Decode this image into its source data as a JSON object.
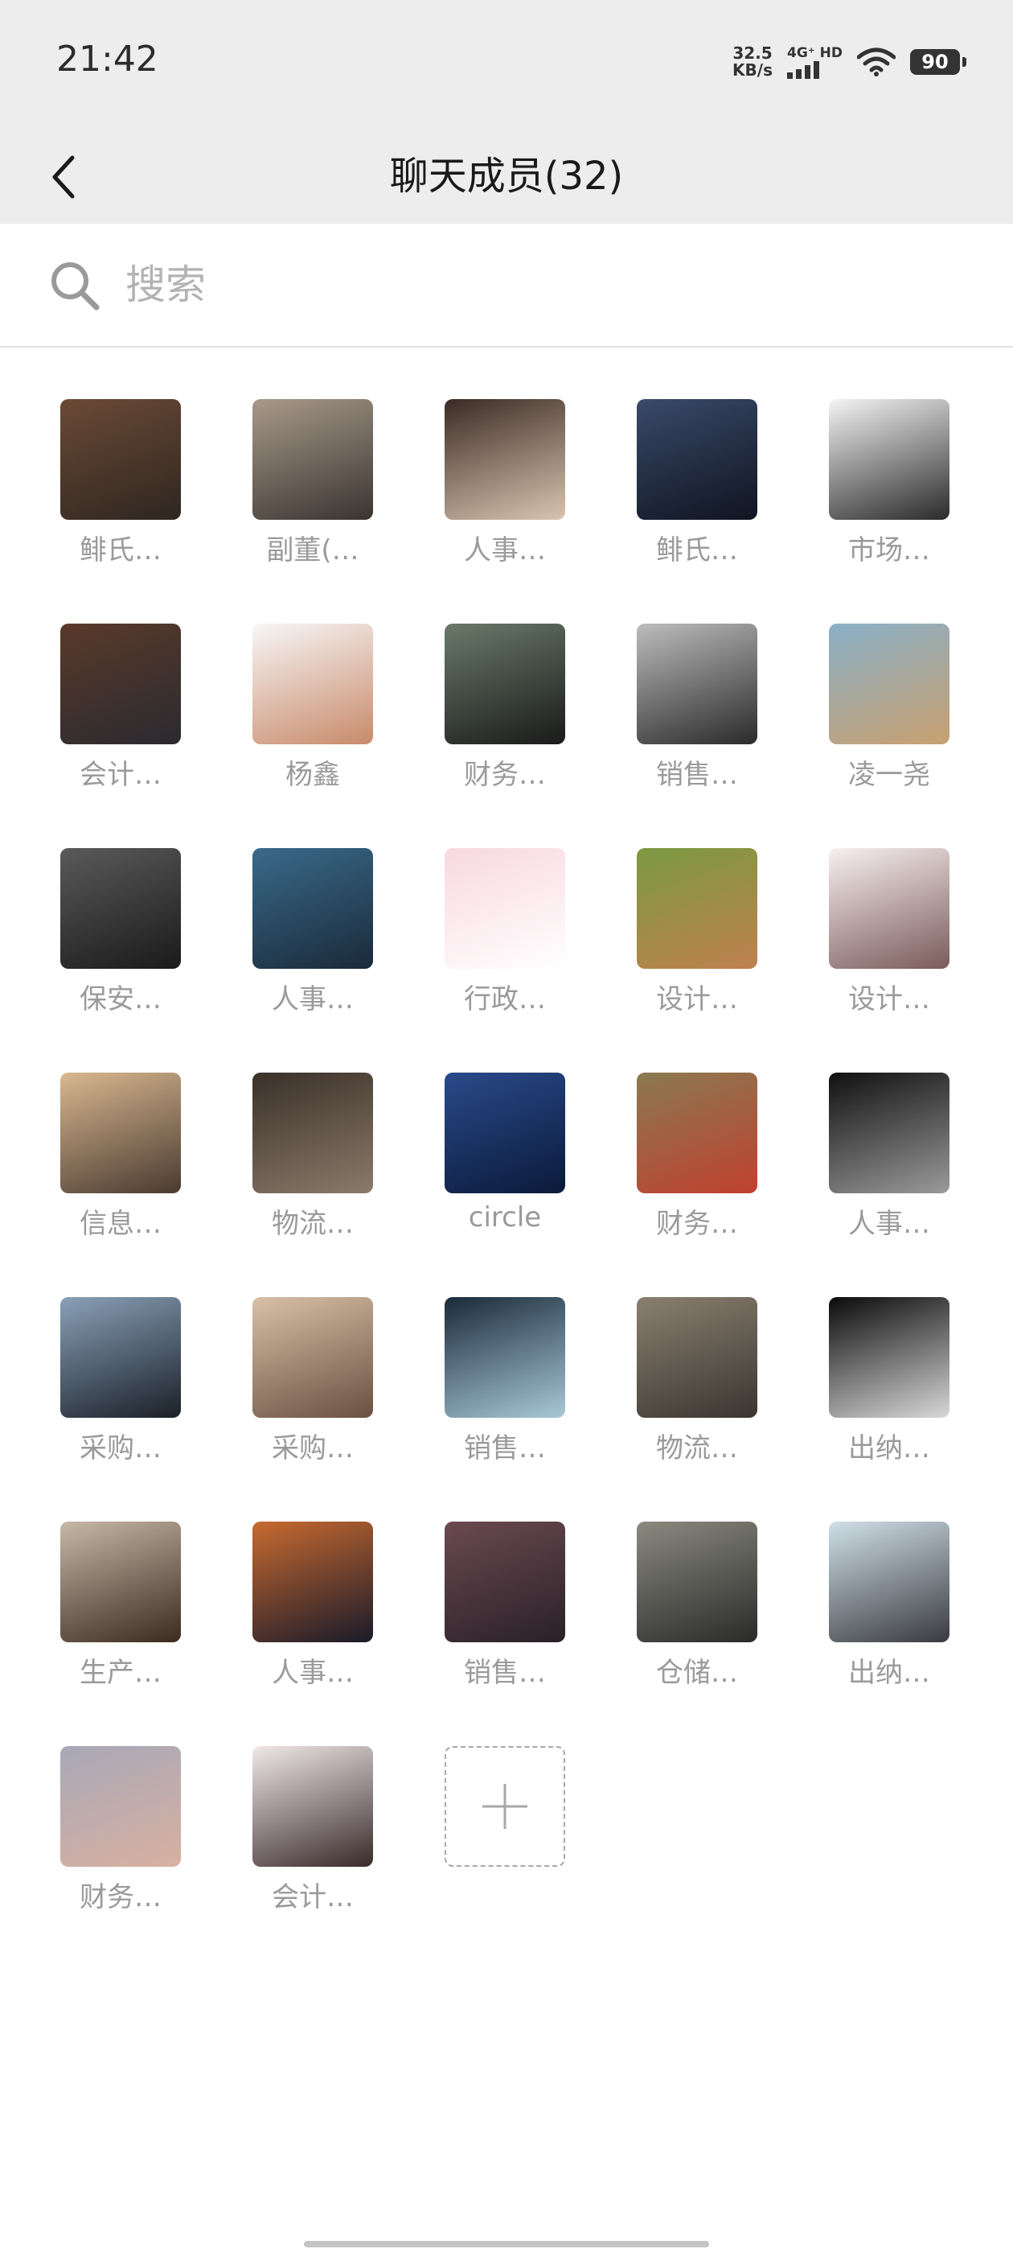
{
  "status_bar": {
    "time": "21:42",
    "net_speed_value": "32.5",
    "net_speed_unit": "KB/s",
    "net_type": "4G⁺ HD",
    "battery": "90"
  },
  "header": {
    "title": "聊天成员(32)"
  },
  "search": {
    "placeholder": "搜索"
  },
  "members": [
    {
      "name": "鲱氏…",
      "avatar_colors": [
        "#6b4a36",
        "#2e2620"
      ]
    },
    {
      "name": "副董(…",
      "avatar_colors": [
        "#a89a8a",
        "#3a3430"
      ]
    },
    {
      "name": "人事…",
      "avatar_colors": [
        "#3a2a24",
        "#d9c5b0"
      ]
    },
    {
      "name": "鲱氏…",
      "avatar_colors": [
        "#3a4a6a",
        "#0f1420"
      ]
    },
    {
      "name": "市场…",
      "avatar_colors": [
        "#f4f4f4",
        "#2a2a2a"
      ]
    },
    {
      "name": "会计…",
      "avatar_colors": [
        "#5a3a2a",
        "#2a2a30"
      ]
    },
    {
      "name": "杨鑫",
      "avatar_colors": [
        "#f7f7f7",
        "#c88a6a"
      ]
    },
    {
      "name": "财务…",
      "avatar_colors": [
        "#6a7a6a",
        "#1a1a1a"
      ]
    },
    {
      "name": "销售…",
      "avatar_colors": [
        "#bdbdbd",
        "#2a2a2a"
      ]
    },
    {
      "name": "凌一尧",
      "avatar_colors": [
        "#8ab0c8",
        "#c8a070"
      ]
    },
    {
      "name": "保安…",
      "avatar_colors": [
        "#5a5a5a",
        "#1a1a1a"
      ]
    },
    {
      "name": "人事…",
      "avatar_colors": [
        "#3a6a8a",
        "#1a2a3a"
      ]
    },
    {
      "name": "行政…",
      "avatar_colors": [
        "#f8d8e0",
        "#ffffff"
      ]
    },
    {
      "name": "设计…",
      "avatar_colors": [
        "#7a9a40",
        "#c08050"
      ]
    },
    {
      "name": "设计…",
      "avatar_colors": [
        "#f8f0f0",
        "#7a5a5a"
      ]
    },
    {
      "name": "信息…",
      "avatar_colors": [
        "#d8b890",
        "#4a3a30"
      ]
    },
    {
      "name": "物流…",
      "avatar_colors": [
        "#3a3028",
        "#8a7a6a"
      ]
    },
    {
      "name": "circle",
      "avatar_colors": [
        "#2a4a8a",
        "#0a1a3a"
      ]
    },
    {
      "name": "财务…",
      "avatar_colors": [
        "#8a7a50",
        "#c04030"
      ]
    },
    {
      "name": "人事…",
      "avatar_colors": [
        "#101010",
        "#9a9a9a"
      ]
    },
    {
      "name": "采购…",
      "avatar_colors": [
        "#8aa0b8",
        "#1a2028"
      ]
    },
    {
      "name": "采购…",
      "avatar_colors": [
        "#d8c0a8",
        "#6a5040"
      ]
    },
    {
      "name": "销售…",
      "avatar_colors": [
        "#1a2a3a",
        "#a8c8d8"
      ]
    },
    {
      "name": "物流…",
      "avatar_colors": [
        "#8a8070",
        "#3a3530"
      ]
    },
    {
      "name": "出纳…",
      "avatar_colors": [
        "#0a0a0a",
        "#d8d8d8"
      ]
    },
    {
      "name": "生产…",
      "avatar_colors": [
        "#c8b8a8",
        "#3a2a20"
      ]
    },
    {
      "name": "人事…",
      "avatar_colors": [
        "#c86a30",
        "#1a1a2a"
      ]
    },
    {
      "name": "销售…",
      "avatar_colors": [
        "#6a4a50",
        "#2a2028"
      ]
    },
    {
      "name": "仓储…",
      "avatar_colors": [
        "#8a8a80",
        "#2a2a2a"
      ]
    },
    {
      "name": "出纳…",
      "avatar_colors": [
        "#d0e0e8",
        "#3a3a40"
      ]
    },
    {
      "name": "财务…",
      "avatar_colors": [
        "#a8a8b8",
        "#d8b0a0"
      ]
    },
    {
      "name": "会计…",
      "avatar_colors": [
        "#f0e8e8",
        "#3a2a2a"
      ]
    }
  ],
  "add_member": {
    "icon": "plus-icon"
  }
}
